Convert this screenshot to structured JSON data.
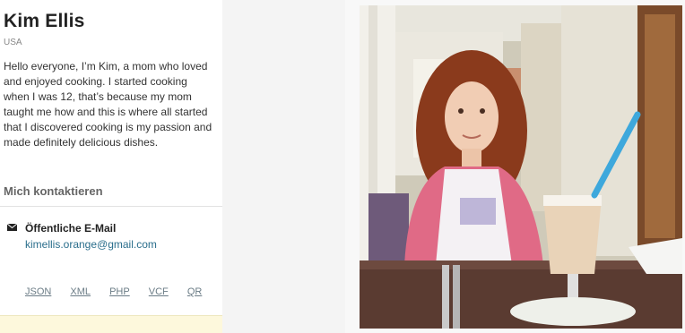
{
  "profile": {
    "name": "Kim Ellis",
    "country": "USA",
    "bio": "Hello everyone, I’m Kim, a mom who loved and enjoyed cooking. I started cooking when I was 12, that’s because my mom taught me how and this is where all started that I discovered cooking is my passion and made definitely delicious dishes."
  },
  "contact": {
    "heading": "Mich kontaktieren",
    "email_label": "Öffentliche E-Mail",
    "email_value": "kimellis.orange@gmail.com"
  },
  "formats": {
    "json": "JSON",
    "xml": "XML",
    "php": "PHP",
    "vcf": "VCF",
    "qr": "QR"
  },
  "icons": {
    "email": "envelope-icon"
  },
  "colors": {
    "link": "#2a6e8c",
    "footer_strip": "#fdf8dc"
  }
}
